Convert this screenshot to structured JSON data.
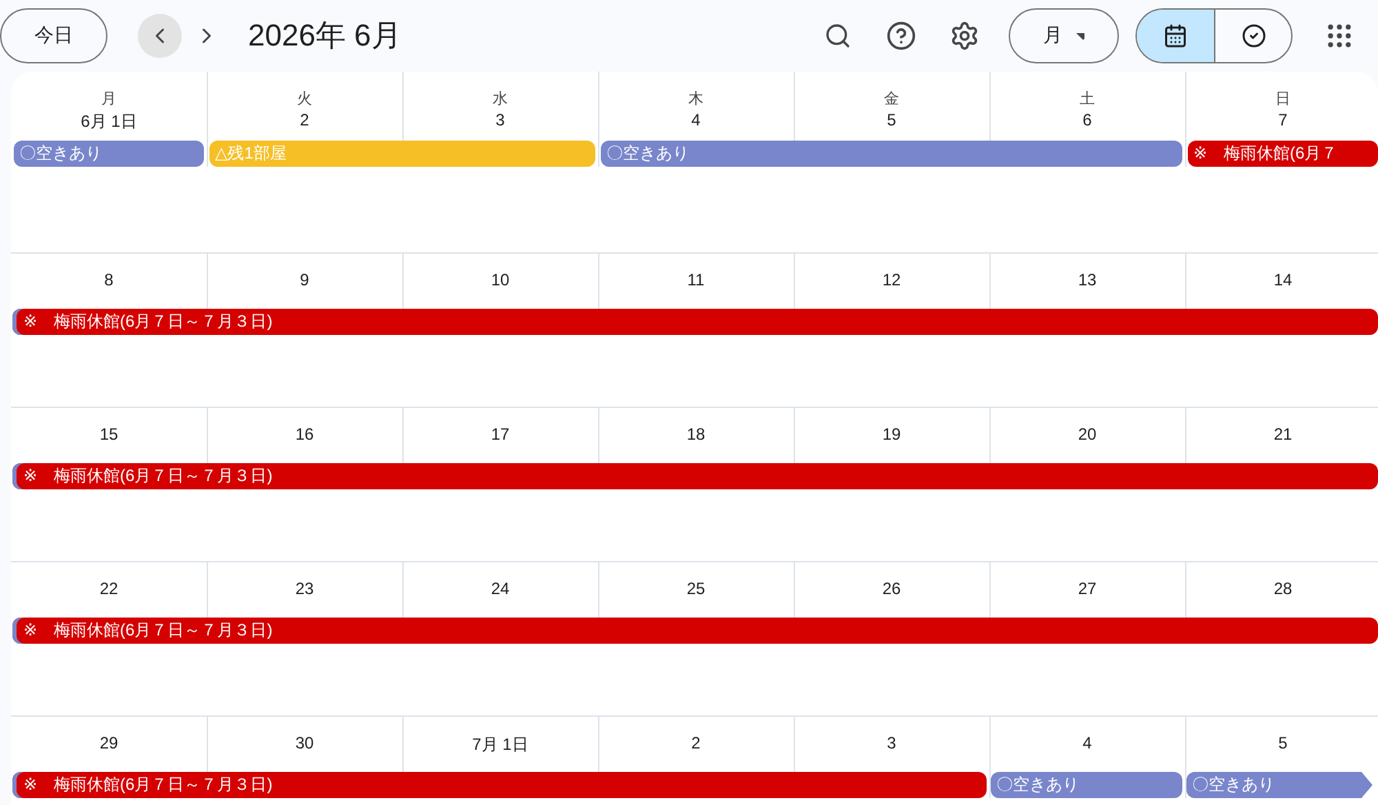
{
  "toolbar": {
    "today_button": "今日",
    "title": "2026年 6月",
    "view_select": "月",
    "view_toggle": [
      {
        "kind": "calendar",
        "selected": true
      },
      {
        "kind": "tasks",
        "selected": false
      }
    ]
  },
  "weekdays": [
    "月",
    "火",
    "水",
    "木",
    "金",
    "土",
    "日"
  ],
  "weeks": [
    {
      "days": [
        "6月 1日",
        "2",
        "3",
        "4",
        "5",
        "6",
        "7"
      ],
      "events": [
        {
          "title": "〇空きあり",
          "color": "#7986cb",
          "continued": false,
          "continues": false
        },
        {
          "title": "△残1部屋",
          "color": "#f6bf26",
          "continued": false,
          "continues": false
        },
        {
          "title": "〇空きあり",
          "color": "#7986cb",
          "continued": false,
          "continues": false
        },
        {
          "title": "※　梅雨休館(6月７",
          "color": "#d50000",
          "continued": false,
          "continues": false
        }
      ]
    },
    {
      "days": [
        "8",
        "9",
        "10",
        "11",
        "12",
        "13",
        "14"
      ],
      "events": [
        {
          "title": "※　梅雨休館(6月７日～７月３日)",
          "color": "#d50000",
          "continued": true,
          "continues": false
        }
      ]
    },
    {
      "days": [
        "15",
        "16",
        "17",
        "18",
        "19",
        "20",
        "21"
      ],
      "events": [
        {
          "title": "※　梅雨休館(6月７日～７月３日)",
          "color": "#d50000",
          "continued": true,
          "continues": false
        }
      ]
    },
    {
      "days": [
        "22",
        "23",
        "24",
        "25",
        "26",
        "27",
        "28"
      ],
      "events": [
        {
          "title": "※　梅雨休館(6月７日～７月３日)",
          "color": "#d50000",
          "continued": true,
          "continues": false
        }
      ]
    },
    {
      "days": [
        "29",
        "30",
        "7月 1日",
        "2",
        "3",
        "4",
        "5"
      ],
      "events": [
        {
          "title": "※　梅雨休館(6月７日～７月３日)",
          "color": "#d50000",
          "continued": true,
          "continues": false
        },
        {
          "title": "〇空きあり",
          "color": "#7986cb",
          "continued": false,
          "continues": false
        },
        {
          "title": "〇空きあり",
          "color": "#7986cb",
          "continued": false,
          "continues": true
        }
      ]
    }
  ]
}
